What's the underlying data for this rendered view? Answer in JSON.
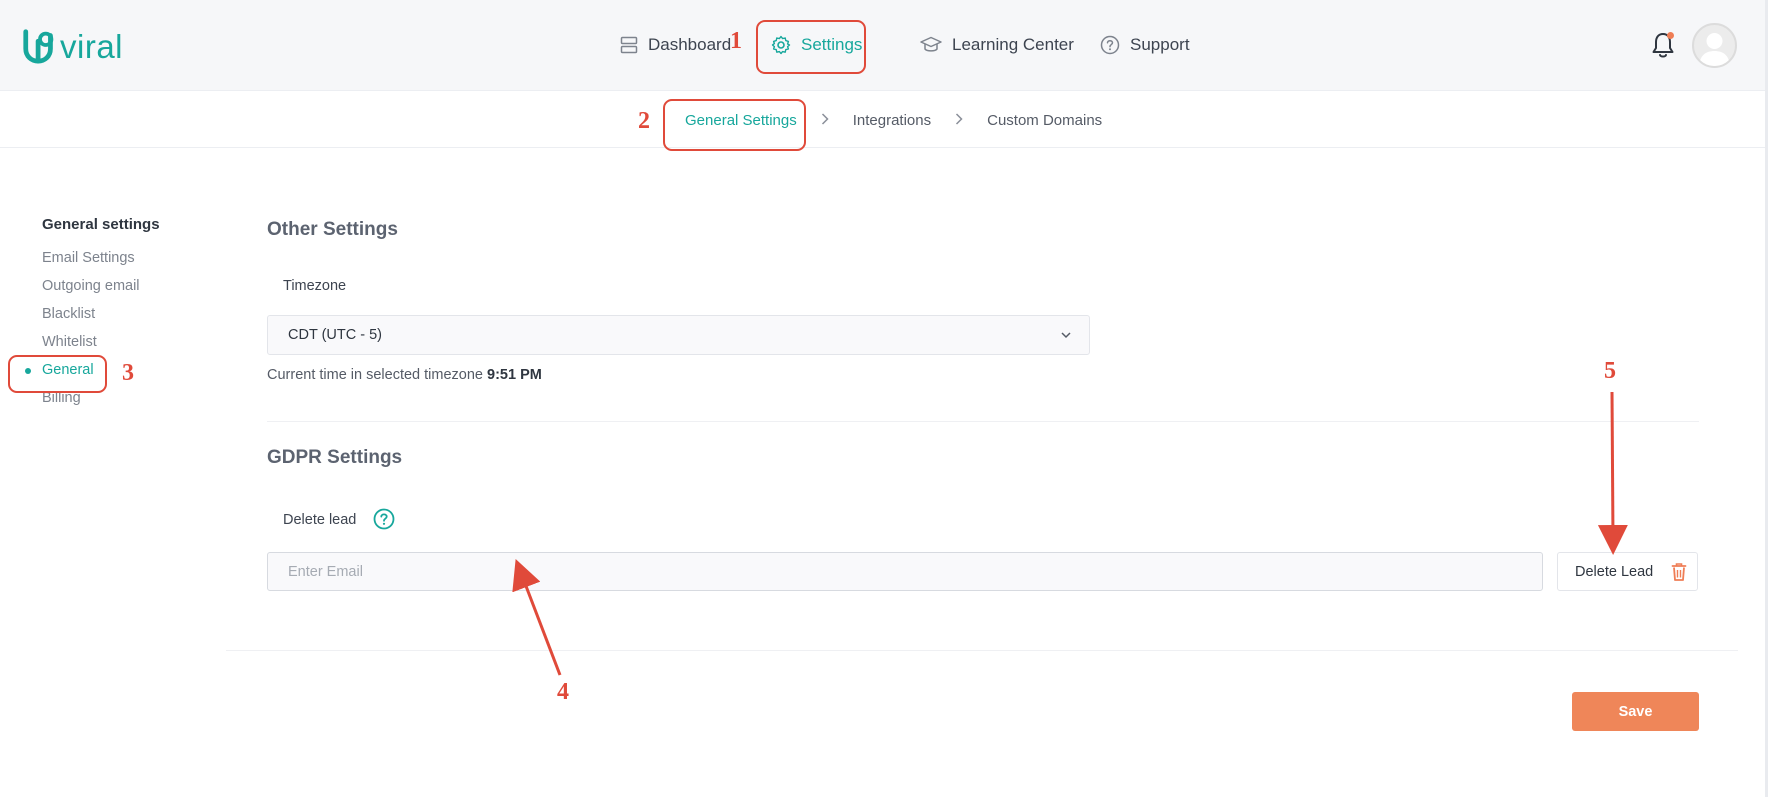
{
  "brand": {
    "logo_text": "viral",
    "accent_color": "#17a79c",
    "cta_color": "#ef8659",
    "annotation_color": "#e04a3a"
  },
  "main_nav": {
    "dashboard": "Dashboard",
    "settings": "Settings",
    "learning_center": "Learning Center",
    "support": "Support"
  },
  "sub_nav": {
    "general_settings": "General Settings",
    "integrations": "Integrations",
    "custom_domains": "Custom Domains"
  },
  "sidebar": {
    "title": "General settings",
    "items": [
      {
        "label": "Email Settings",
        "active": false
      },
      {
        "label": "Outgoing email",
        "active": false
      },
      {
        "label": "Blacklist",
        "active": false
      },
      {
        "label": "Whitelist",
        "active": false
      },
      {
        "label": "General",
        "active": true
      },
      {
        "label": "Billing",
        "active": false
      }
    ]
  },
  "other_settings": {
    "heading": "Other Settings",
    "timezone_label": "Timezone",
    "timezone_value": "CDT (UTC - 5)",
    "current_time_prefix": "Current time in selected timezone",
    "current_time_value": "9:51 PM"
  },
  "gdpr_settings": {
    "heading": "GDPR Settings",
    "delete_lead_label": "Delete lead",
    "email_placeholder": "Enter Email",
    "delete_button": "Delete Lead"
  },
  "save_button": "Save",
  "annotations": [
    "1",
    "2",
    "3",
    "4",
    "5"
  ]
}
